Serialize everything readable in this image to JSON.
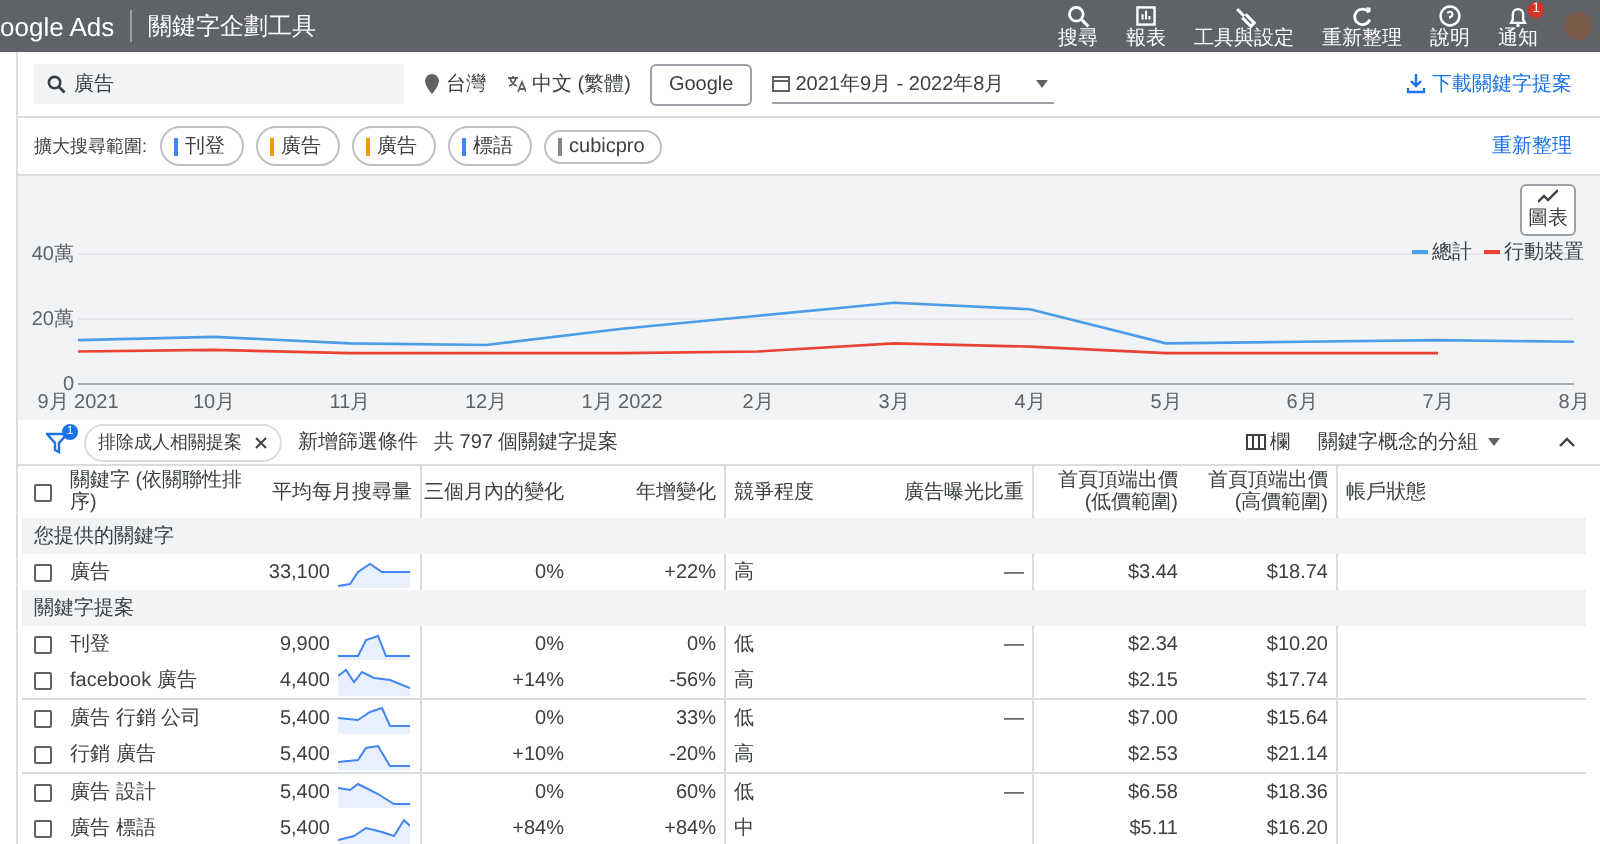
{
  "top_bar": {
    "product": "oogle Ads",
    "title": "關鍵字企劃工具",
    "actions": [
      {
        "label": "搜尋"
      },
      {
        "label": "報表"
      },
      {
        "label": "工具與設定"
      },
      {
        "label": "重新整理"
      },
      {
        "label": "說明"
      },
      {
        "label": "通知",
        "badge": "1"
      }
    ]
  },
  "search_bar": {
    "query": "廣告",
    "location": "台灣",
    "language": "中文 (繁體)",
    "network": "Google",
    "date_range": "2021年9月 - 2022年8月",
    "download": "下載關鍵字提案"
  },
  "refine": {
    "label": "擴大搜尋範圍:",
    "chips": [
      {
        "label": "刊登",
        "color": "#4285f4"
      },
      {
        "label": "廣告",
        "color": "#f29900"
      },
      {
        "label": "廣告",
        "color": "#f29900"
      },
      {
        "label": "標語",
        "color": "#4285f4"
      },
      {
        "label": "cubicpro",
        "color": "#80868b"
      }
    ],
    "link": "重新整理"
  },
  "chart": {
    "button": "圖表",
    "chart_data": {
      "type": "line",
      "categories": [
        "9月 2021",
        "10月",
        "11月",
        "12月",
        "1月 2022",
        "2月",
        "3月",
        "4月",
        "5月",
        "6月",
        "7月",
        "8月"
      ],
      "ylim": [
        0,
        40
      ],
      "yticks": [
        {
          "value": 0,
          "label": "0"
        },
        {
          "value": 20,
          "label": "20萬"
        },
        {
          "value": 40,
          "label": "40萬"
        }
      ],
      "series": [
        {
          "name": "總計",
          "color": "#4c9de8",
          "values": [
            13.5,
            14.5,
            12.5,
            12,
            17,
            21,
            25,
            23,
            12.5,
            13,
            13.5,
            13
          ]
        },
        {
          "name": "行動裝置",
          "color": "#ea4335",
          "values": [
            10,
            10.5,
            9.5,
            9.5,
            9.5,
            10,
            12.5,
            11.5,
            9.5,
            9.5,
            9.5,
            null
          ]
        }
      ]
    }
  },
  "filters": {
    "badge": "1",
    "chips": [
      {
        "label": "排除成人相關提案"
      }
    ],
    "add_filter": "新增篩選條件",
    "count": "共 797 個關鍵字提案",
    "columns": "欄",
    "grouping": "關鍵字概念的分組"
  },
  "table": {
    "select_all_checked": false,
    "columns": [
      "關鍵字 (依關聯性排序)",
      "平均每月搜尋量",
      "三個月內的變化",
      "年增變化",
      "競爭程度",
      "廣告曝光比重",
      "首頁頂端出價 (低價範圍)",
      "首頁頂端出價 (高價範圍)",
      "帳戶狀態"
    ],
    "sections": [
      {
        "title": "您提供的關鍵字",
        "groups": [
          {
            "rows": [
              {
                "checked": false,
                "keyword": "廣告",
                "searches": "33,100",
                "three_month": "0%",
                "yoy": "+22%",
                "competition": "高",
                "impression_share": "—",
                "bid_low": "$3.44",
                "bid_high": "$18.74"
              }
            ]
          }
        ]
      },
      {
        "title": "關鍵字提案",
        "groups": [
          {
            "rows": [
              {
                "checked": false,
                "keyword": "刊登",
                "searches": "9,900",
                "three_month": "0%",
                "yoy": "0%",
                "competition": "低",
                "impression_share": "—",
                "bid_low": "$2.34",
                "bid_high": "$10.20"
              },
              {
                "checked": false,
                "keyword": "facebook 廣告",
                "searches": "4,400",
                "three_month": "+14%",
                "yoy": "-56%",
                "competition": "高",
                "bid_low": "$2.15",
                "bid_high": "$17.74"
              }
            ]
          },
          {
            "rows": [
              {
                "checked": false,
                "keyword": "廣告 行銷 公司",
                "searches": "5,400",
                "three_month": "0%",
                "yoy": "33%",
                "competition": "低",
                "impression_share": "—",
                "bid_low": "$7.00",
                "bid_high": "$15.64"
              },
              {
                "checked": false,
                "keyword": "行銷 廣告",
                "searches": "5,400",
                "three_month": "+10%",
                "yoy": "-20%",
                "competition": "高",
                "bid_low": "$2.53",
                "bid_high": "$21.14"
              }
            ]
          },
          {
            "rows": [
              {
                "checked": false,
                "keyword": "廣告 設計",
                "searches": "5,400",
                "three_month": "0%",
                "yoy": "60%",
                "competition": "低",
                "impression_share": "—",
                "bid_low": "$6.58",
                "bid_high": "$18.36"
              },
              {
                "checked": false,
                "keyword": "廣告 標語",
                "searches": "5,400",
                "three_month": "+84%",
                "yoy": "+84%",
                "competition": "中",
                "bid_low": "$5.11",
                "bid_high": "$16.20"
              }
            ]
          }
        ]
      }
    ]
  }
}
